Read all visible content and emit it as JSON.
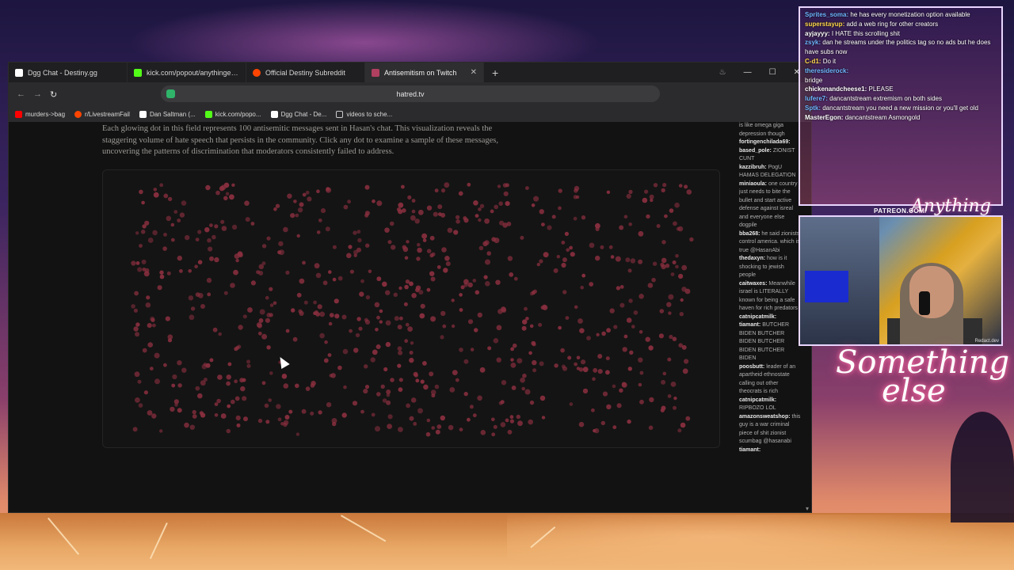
{
  "browser": {
    "tabs": [
      {
        "title": "Dgg Chat - Destiny.gg",
        "color": "#ffffff",
        "active": false
      },
      {
        "title": "kick.com/popout/anythingelse/chat",
        "color": "#53fc18",
        "active": false
      },
      {
        "title": "Official Destiny Subreddit",
        "color": "#ff4500",
        "active": false
      },
      {
        "title": "Antisemitism on Twitch",
        "color": "#b04060",
        "active": true
      }
    ],
    "new_tab": "+",
    "url": "hatred.tv",
    "bookmarks": [
      {
        "label": "murders->bag",
        "color": "#ff0000"
      },
      {
        "label": "r/LivestreamFail",
        "color": "#ff4500"
      },
      {
        "label": "Dan Saltman (...",
        "color": "#ffffff"
      },
      {
        "label": "kick.com/popo...",
        "color": "#53fc18"
      },
      {
        "label": "Dgg Chat - De...",
        "color": "#ffffff"
      },
      {
        "label": "videos to sche...",
        "color": "#cccccc"
      }
    ]
  },
  "page": {
    "intro": "Each glowing dot in this field represents 100 antisemitic messages sent in Hasan's chat. This visualization reveals the staggering volume of hate speech that persists in the community. Click any dot to examine a sample of these messages, uncovering the patterns of discrimination that moderators consistently failed to address.",
    "dot_color": "#8a2f3f"
  },
  "side_chat": [
    {
      "user": "",
      "text": "is like omega giga depression though"
    },
    {
      "user": "fortingenchilada69:",
      "text": ""
    },
    {
      "user": "based_pole:",
      "text": "ZIONIST CUNT"
    },
    {
      "user": "kazzibruh:",
      "text": "PogU HAMAS DELEGATION"
    },
    {
      "user": "miniaoula:",
      "text": "one country just needs to bite the bullet and start active defense against isreal and everyone else dogpile"
    },
    {
      "user": "bba268:",
      "text": "he said zionists control america. which is true @HasanAbi"
    },
    {
      "user": "thedaxyn:",
      "text": "how is it shocking to jewish people"
    },
    {
      "user": "caitwaxes:",
      "text": "Meanwhile israel is LITERALLY known for being a safe haven for rich predators"
    },
    {
      "user": "catnipcatmilk:",
      "text": ""
    },
    {
      "user": "tiamant:",
      "text": "BUTCHER BIDEN BUTCHER BIDEN BUTCHER BIDEN BUTCHER BIDEN"
    },
    {
      "user": "poosbutt:",
      "text": "leader of an apartheid ethnostate calling out other theocrats is rich"
    },
    {
      "user": "catnipcatmilk:",
      "text": "RIPBOZO LOL"
    },
    {
      "user": "amazonsweatshop:",
      "text": "this guy is a war criminal piece of shit zionist scumbag @hasanabi"
    },
    {
      "user": "tiamant:",
      "text": ""
    }
  ],
  "stream_chat": [
    {
      "name": "Sprites_soma:",
      "text": "he has every monetization option available",
      "color": "#6fb7ff"
    },
    {
      "name": "superstayup:",
      "text": "add a web ring for other creators",
      "color": "#ffd84a"
    },
    {
      "name": "ayjayyy:",
      "text": "I HATE this scrolling shit",
      "color": "#ffffff"
    },
    {
      "name": "zsyk:",
      "text": "dan he streams under the politics tag so no ads but he does have subs now",
      "color": "#6fb7ff"
    },
    {
      "name": "C-d1:",
      "text": "Do it",
      "color": "#ffd84a"
    },
    {
      "name": "theresiderock:",
      "text": "",
      "color": "#6fb7ff"
    },
    {
      "name": "",
      "text": "bridge",
      "color": "#ffffff"
    },
    {
      "name": "chickenandcheese1:",
      "text": "PLEASE",
      "color": "#ffffff"
    },
    {
      "name": "lufere7:",
      "text": "dancantstream extremism on both sides",
      "color": "#6fb7ff"
    },
    {
      "name": "Sptk:",
      "text": "dancantstream you need a new mission or you'll get old",
      "color": "#6fb7ff"
    },
    {
      "name": "MasterEgon:",
      "text": "dancantstream Asmongold",
      "color": "#ffffff"
    }
  ],
  "overlay": {
    "patreon": "PATREON.COM/",
    "logo": "Anything Else",
    "neon_line1": "Something",
    "neon_line2": "else",
    "cam_tag": "Redact.dev"
  }
}
